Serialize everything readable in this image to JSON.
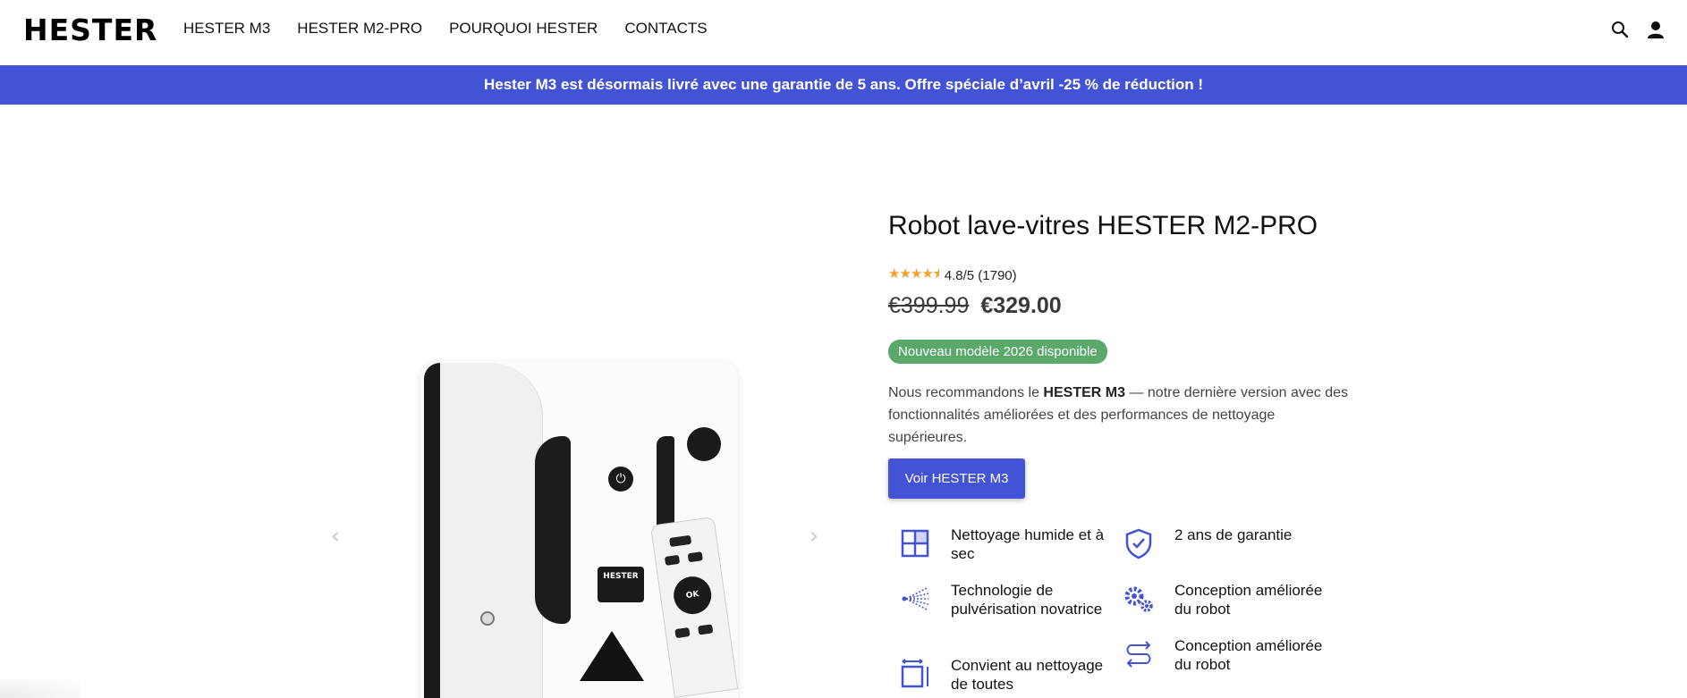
{
  "header": {
    "logo": "HESTER",
    "nav": [
      {
        "label": "HESTER M3"
      },
      {
        "label": "HESTER M2-PRO"
      },
      {
        "label": "POURQUOI HESTER"
      },
      {
        "label": "CONTACTS"
      }
    ],
    "icons": [
      "search-icon",
      "user-icon"
    ]
  },
  "announcement": {
    "text": "Hester M3 est désormais livré avec une garantie de 5 ans. Offre spéciale d’avril -25 % de réduction !"
  },
  "gallery": {
    "prev_arrow": "‹",
    "next_arrow": "›",
    "robot_brand": "HESTER",
    "remote_ok": "OK"
  },
  "product": {
    "title": "Robot lave-vitres HESTER M2-PRO",
    "rating": {
      "stars": "★★★★⯨",
      "value": 4.5,
      "text": "4.8/5 (1790)"
    },
    "old_price": "€399.99",
    "new_price": "€329.00",
    "badge": "Nouveau modèle 2026 disponible",
    "description": {
      "before": "Nous recommandons le ",
      "bold": "HESTER M3",
      "after": " — notre dernière version avec des fonctionnalités améliorées et des performances de nettoyage supérieures."
    },
    "cta_label": "Voir HESTER M3",
    "features": [
      {
        "icon": "grid-window-icon",
        "text": "Nettoyage humide et à sec"
      },
      {
        "icon": "shield-check-icon",
        "text": "2 ans de garantie"
      },
      {
        "icon": "spray-icon",
        "text": "Technologie de pulvérisation novatrice"
      },
      {
        "icon": "gears-icon",
        "text": "Conception améliorée du robot"
      },
      {
        "icon": "resize-icon",
        "text": "Convient au nettoyage de toutes"
      },
      {
        "icon": "route-arrows-icon",
        "text": "Conception améliorée du robot"
      }
    ]
  },
  "colors": {
    "accent": "#4353d6",
    "badge_green": "#5aa86a",
    "star": "#f2a12b"
  }
}
